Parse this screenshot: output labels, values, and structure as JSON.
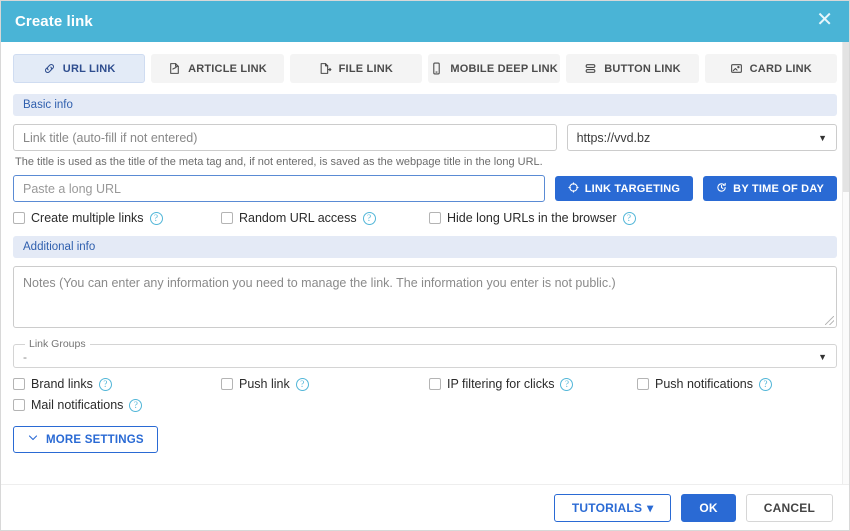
{
  "header": {
    "title": "Create link",
    "close_icon": "close-icon"
  },
  "tabs": [
    {
      "label": "URL LINK",
      "icon": "link-chain-icon",
      "active": true
    },
    {
      "label": "ARTICLE LINK",
      "icon": "article-page-icon",
      "active": false
    },
    {
      "label": "FILE LINK",
      "icon": "file-upload-icon",
      "active": false
    },
    {
      "label": "MOBILE DEEP LINK",
      "icon": "mobile-phone-icon",
      "active": false
    },
    {
      "label": "BUTTON LINK",
      "icon": "stacked-buttons-icon",
      "active": false
    },
    {
      "label": "CARD LINK",
      "icon": "card-image-icon",
      "active": false
    }
  ],
  "basic_info": {
    "section_label": "Basic info",
    "title_input": {
      "value": "",
      "placeholder": "Link title (auto-fill if not entered)"
    },
    "domain_select": {
      "value": "https://vvd.bz",
      "caret": "▼"
    },
    "hint": "The title is used as the title of the meta tag and, if not entered, is saved as the webpage title in the long URL.",
    "url_input": {
      "value": "",
      "placeholder": "Paste a long URL"
    },
    "link_targeting_button": {
      "label": "LINK TARGETING",
      "icon": "target-crosshair-icon"
    },
    "by_time_of_day_button": {
      "label": "BY TIME OF DAY",
      "icon": "clock-icon"
    },
    "checkboxes": [
      {
        "label": "Create multiple links",
        "checked": false,
        "help": "?"
      },
      {
        "label": "Random URL access",
        "checked": false,
        "help": "?"
      },
      {
        "label": "Hide long URLs in the browser",
        "checked": false,
        "help": "?"
      }
    ]
  },
  "additional_info": {
    "section_label": "Additional info",
    "notes": {
      "value": "",
      "placeholder": "Notes (You can enter any information you need to manage the link. The information you enter is not public.)"
    },
    "link_groups": {
      "legend": "Link Groups",
      "value": "-",
      "caret": "▼"
    },
    "checkboxes": [
      {
        "label": "Brand links",
        "checked": false,
        "help": "?"
      },
      {
        "label": "Push link",
        "checked": false,
        "help": "?"
      },
      {
        "label": "IP filtering for clicks",
        "checked": false,
        "help": "?"
      },
      {
        "label": "Push notifications",
        "checked": false,
        "help": "?"
      },
      {
        "label": "Mail notifications",
        "checked": false,
        "help": "?"
      }
    ],
    "more_settings_button": {
      "label": "MORE SETTINGS",
      "icon": "chevron-down-icon"
    }
  },
  "footer": {
    "tutorials_label": "TUTORIALS",
    "tutorials_caret": "▾",
    "ok_label": "OK",
    "cancel_label": "CANCEL"
  },
  "colors": {
    "header_bg": "#4ab4d6",
    "accent_blue": "#2a6ad4",
    "section_bg": "#e4eaf6",
    "active_tab_bg": "#e3ebf7",
    "help_icon": "#52b6d8"
  }
}
